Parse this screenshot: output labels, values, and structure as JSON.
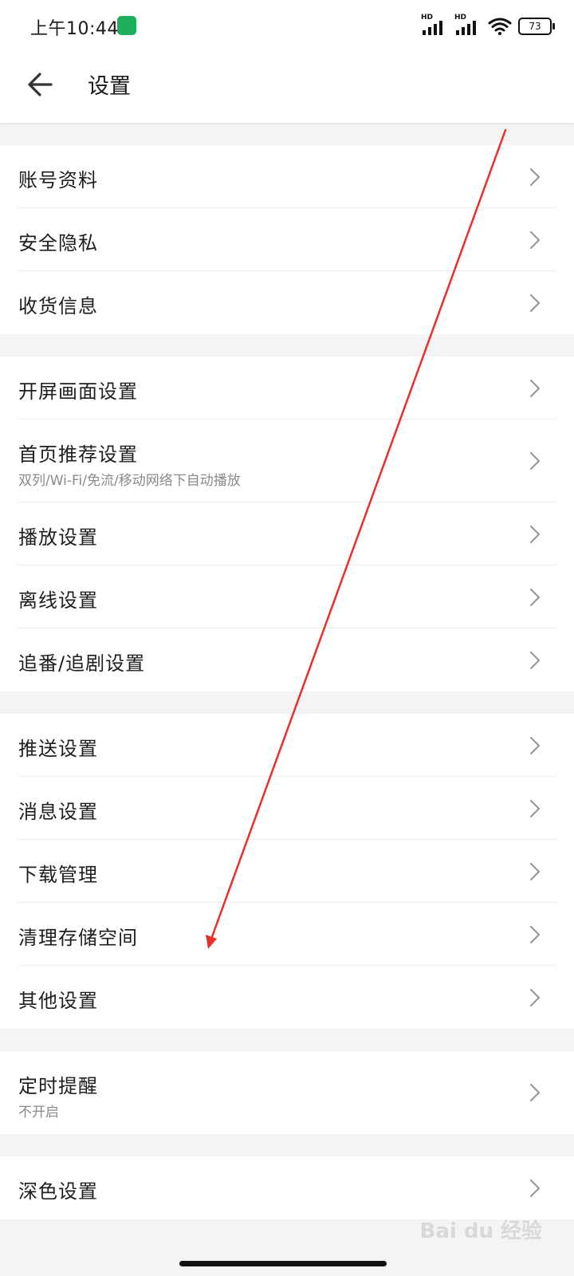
{
  "status_bar": {
    "time": "上午10:44",
    "network_labels": [
      "HD",
      "HD"
    ],
    "battery": "73"
  },
  "header": {
    "title": "设置",
    "back_icon": "arrow-left-icon"
  },
  "groups": [
    {
      "items": [
        {
          "label": "账号资料"
        },
        {
          "label": "安全隐私"
        },
        {
          "label": "收货信息"
        }
      ]
    },
    {
      "items": [
        {
          "label": "开屏画面设置"
        },
        {
          "label": "首页推荐设置",
          "subtitle": "双列/Wi-Fi/免流/移动网络下自动播放"
        },
        {
          "label": "播放设置"
        },
        {
          "label": "离线设置"
        },
        {
          "label": "追番/追剧设置"
        }
      ]
    },
    {
      "items": [
        {
          "label": "推送设置"
        },
        {
          "label": "消息设置"
        },
        {
          "label": "下载管理"
        },
        {
          "label": "清理存储空间"
        },
        {
          "label": "其他设置"
        }
      ]
    },
    {
      "items": [
        {
          "label": "定时提醒",
          "subtitle": "不开启"
        }
      ]
    },
    {
      "items": [
        {
          "label": "深色设置"
        }
      ]
    }
  ],
  "colors": {
    "annotation_arrow": "#e8302a",
    "background": "#f4f4f4",
    "row_background": "#ffffff"
  }
}
